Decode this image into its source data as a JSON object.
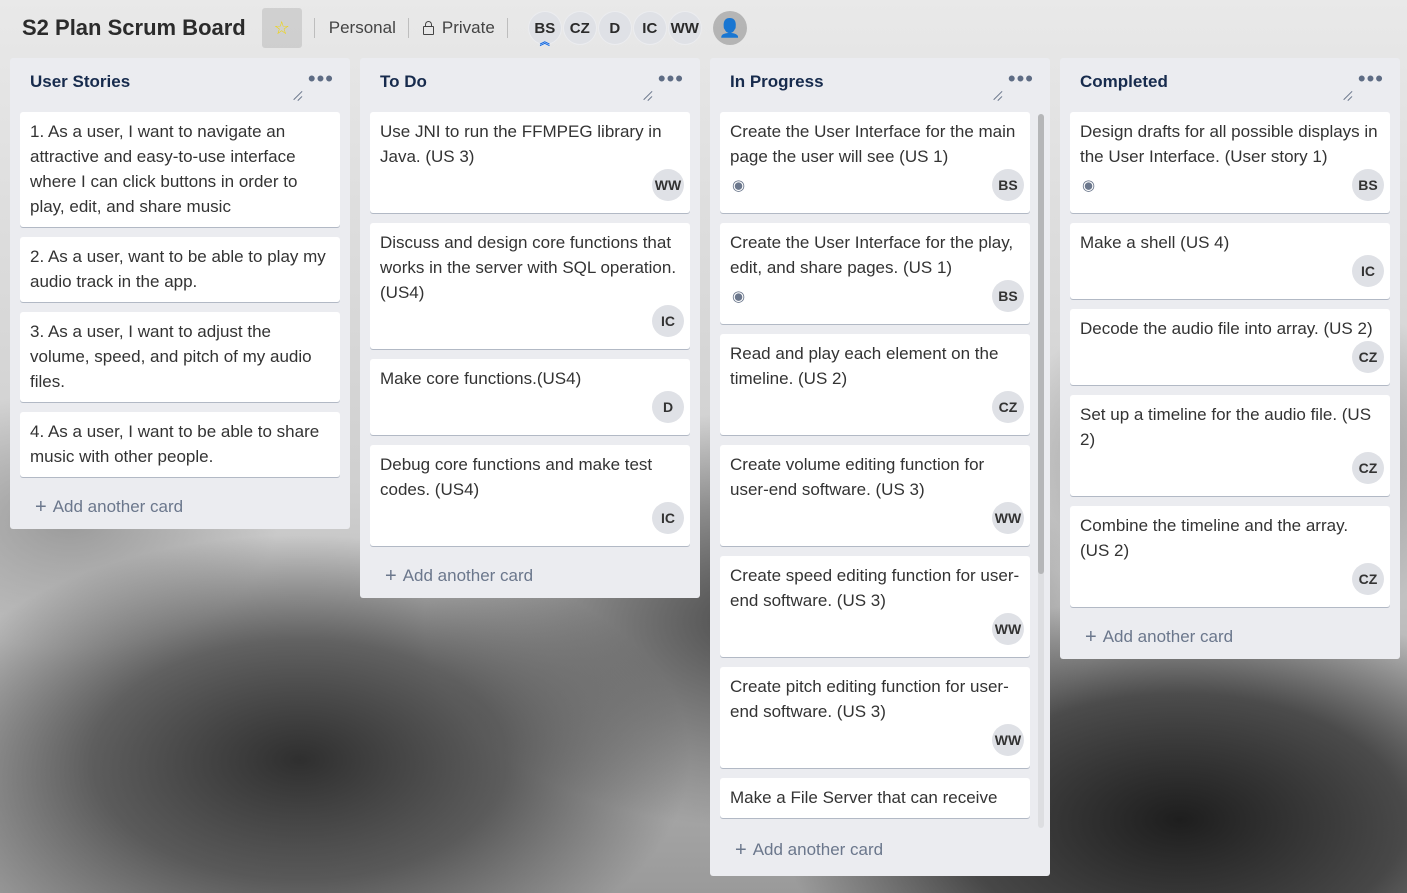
{
  "header": {
    "board_title": "S2 Plan Scrum Board",
    "team_label": "Personal",
    "visibility_label": "Private",
    "members": [
      "BS",
      "CZ",
      "D",
      "IC",
      "WW"
    ]
  },
  "add_card_label": "Add another card",
  "lists": [
    {
      "title": "User Stories",
      "cards": [
        {
          "text": "1. As a user, I want to navigate an attractive and easy-to-use interface where I can click buttons in order to play, edit, and share music",
          "member": ""
        },
        {
          "text": "2. As a user, want to be able to play my audio track in the app.",
          "member": ""
        },
        {
          "text": "3. As a user, I want to adjust the volume, speed, and pitch of my audio files.",
          "member": ""
        },
        {
          "text": "4. As a user, I want to be able to share music with other people.",
          "member": ""
        }
      ]
    },
    {
      "title": "To Do",
      "cards": [
        {
          "text": "Use JNI to run the FFMPEG library in Java. (US 3)",
          "member": "WW"
        },
        {
          "text": "Discuss and design core functions that works in the server with SQL operation. (US4)",
          "member": "IC"
        },
        {
          "text": "Make core functions.(US4)",
          "member": "D"
        },
        {
          "text": "Debug core functions and make test codes. (US4)",
          "member": "IC"
        }
      ]
    },
    {
      "title": "In Progress",
      "cards": [
        {
          "text": "Create the User Interface for the main page the user will see (US 1)",
          "member": "BS",
          "watch": true
        },
        {
          "text": "Create the User Interface for the play, edit, and share pages. (US 1)",
          "member": "BS",
          "watch": true
        },
        {
          "text": "Read and play each element on the timeline. (US 2)",
          "member": "CZ"
        },
        {
          "text": "Create volume editing function for user-end software. (US 3)",
          "member": "WW"
        },
        {
          "text": "Create speed editing function for user-end software. (US 3)",
          "member": "WW"
        },
        {
          "text": "Create pitch editing function for user-end software. (US 3)",
          "member": "WW"
        },
        {
          "text": "Make a File Server that can receive",
          "member": ""
        }
      ]
    },
    {
      "title": "Completed",
      "cards": [
        {
          "text": "Design drafts for all possible displays in the User Interface. (User story 1)",
          "member": "BS",
          "watch": true
        },
        {
          "text": "Make a shell (US 4)",
          "member": "IC"
        },
        {
          "text": "Decode the audio file into array. (US 2)",
          "member": "CZ"
        },
        {
          "text": "Set up a timeline for the audio file. (US 2)",
          "member": "CZ"
        },
        {
          "text": "Combine the timeline and the array. (US 2)",
          "member": "CZ"
        }
      ]
    }
  ]
}
